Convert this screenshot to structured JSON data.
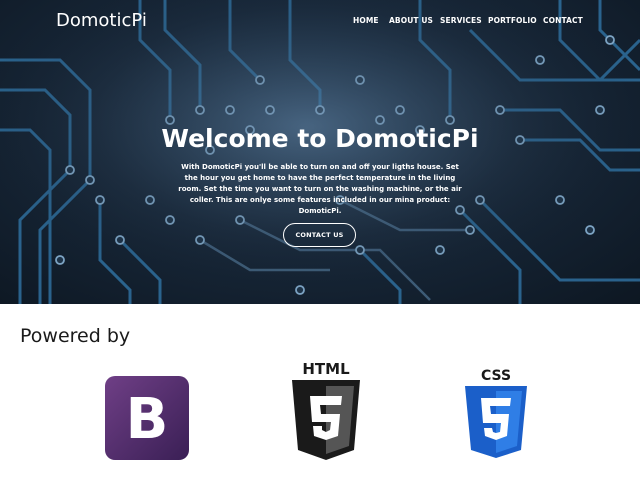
{
  "navbar": {
    "brand": "DomoticPi",
    "items": [
      "HOME",
      "ABOUT US",
      "SERVICES",
      "PORTFOLIO",
      "CONTACT"
    ]
  },
  "hero": {
    "title": "Welcome to DomoticPi",
    "text": "With DomoticPi you'll be able to turn on and off your ligths house. Set the hour you get home to have the perfect temperature in the living room. Set the time you want to turn on the washing machine, or the air coller. This are onlye some features included in our mina product: DomoticPi.",
    "button_label": "CONTACT US"
  },
  "powered": {
    "label": "Powered by",
    "logos": [
      {
        "name": "bootstrap",
        "letter": "B",
        "color": "#563d7c"
      },
      {
        "name": "html5",
        "caption": "HTML",
        "color": "#e34f26"
      },
      {
        "name": "css3",
        "caption": "CSS",
        "color": "#1572b6"
      }
    ]
  },
  "colors": {
    "hero_bg": "#18283a",
    "text_on_hero": "#ffffff"
  }
}
